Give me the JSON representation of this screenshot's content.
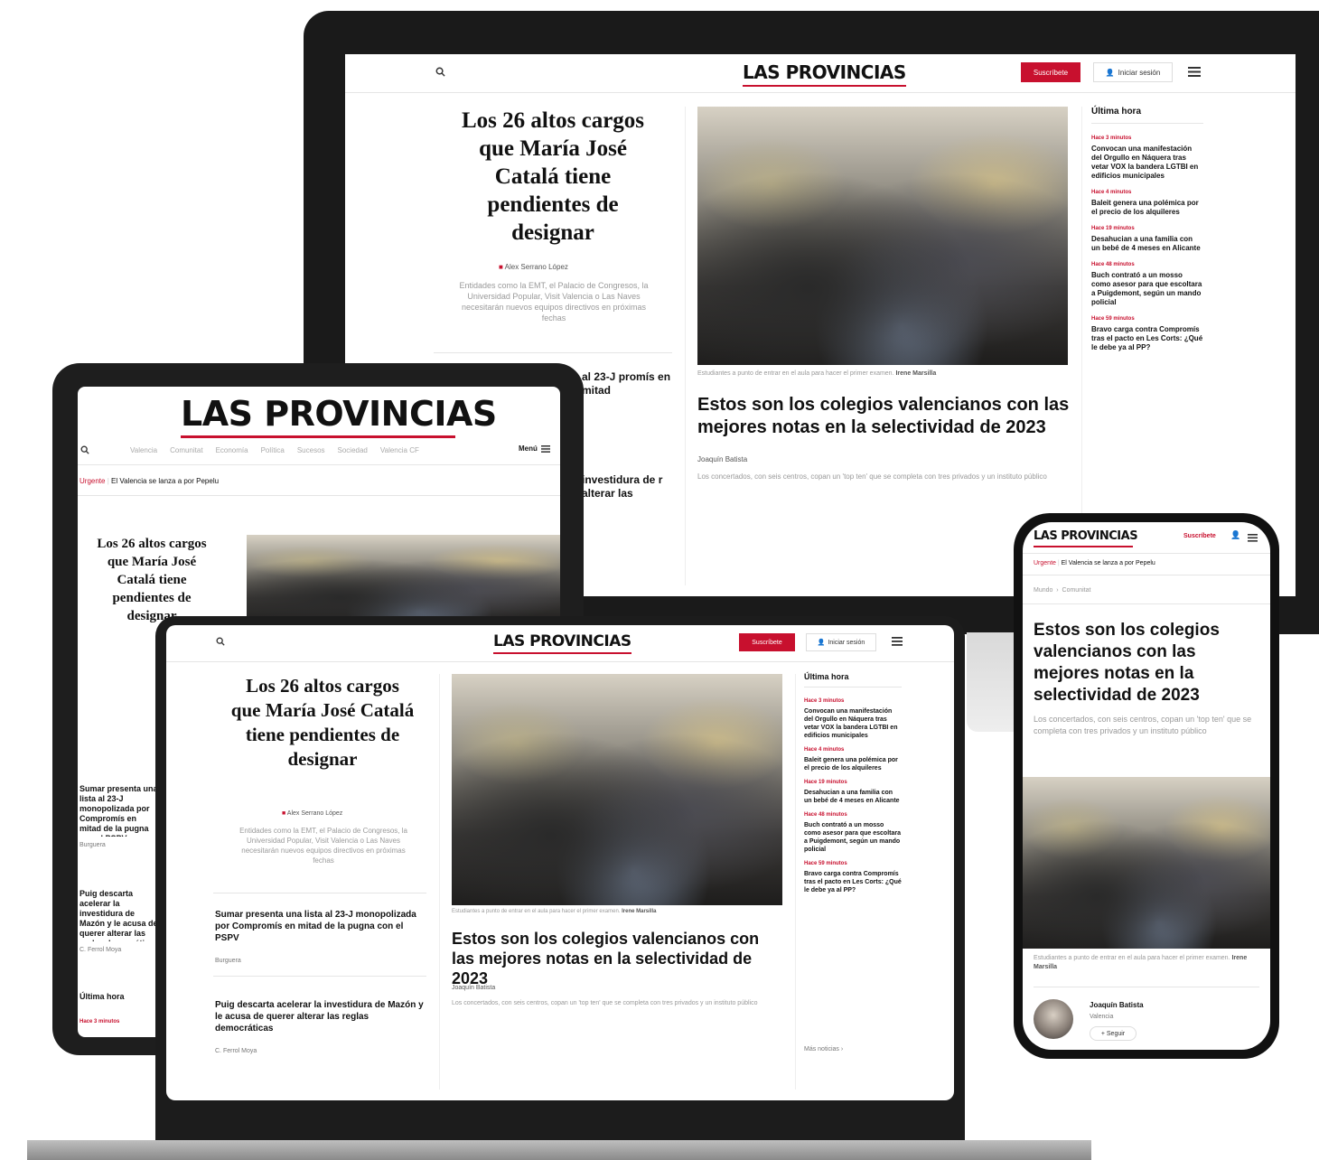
{
  "brand": {
    "name": "LAS PROVINCIAS",
    "accent": "#c8102e"
  },
  "header": {
    "subscribe": "Suscríbete",
    "login": "Iniciar sesión",
    "menu": "Menú"
  },
  "nav": {
    "items": [
      "Valencia",
      "Comunitat",
      "Economía",
      "Política",
      "Sucesos",
      "Sociedad",
      "Valencia CF"
    ]
  },
  "ticker": {
    "label": "Urgente",
    "text": "El Valencia se lanza a por Pepelu"
  },
  "phone_breadcrumb": {
    "section": "Mundo",
    "subsection": "Comunitat"
  },
  "main_story": {
    "title": "Los 26 altos cargos que María José Catalá tiene pendientes de designar",
    "author": "Alex Serrano López",
    "summary": "Entidades como la EMT, el Palacio de Congresos, la Universidad Popular, Visit Valencia o Las Naves necesitarán nuevos equipos directivos en próximas fechas"
  },
  "secondary_stories": [
    {
      "title": "Sumar presenta una lista al 23-J monopolizada por Compromís en mitad de la pugna con el PSPV",
      "author": "Burguera"
    },
    {
      "title": "Puig descarta acelerar la investidura de Mazón y le acusa de querer alterar las reglas democráticas",
      "author": "C. Ferrol Moya"
    }
  ],
  "feature": {
    "caption": "Estudiantes a punto de entrar en el aula para hacer el primer examen.",
    "caption_credit": "Irene Marsilla",
    "title": "Estos son los colegios valencianos con las mejores notas en la selectividad de 2023",
    "author": "Joaquín Batista",
    "summary": "Los concertados, con seis centros, copan un 'top ten' que se completa con tres privados y un instituto público"
  },
  "last_hour": {
    "heading": "Última hora",
    "items": [
      {
        "time": "Hace 3 minutos",
        "title": "Convocan una manifestación del Orgullo en Náquera tras vetar VOX la bandera LGTBI en edificios municipales"
      },
      {
        "time": "Hace 4 minutos",
        "title": "Baleit genera una polémica por el precio de los alquileres"
      },
      {
        "time": "Hace 19 minutos",
        "title": "Desahucian a una familia con un bebé de 4 meses en Alicante"
      },
      {
        "time": "Hace 48 minutos",
        "title": "Buch contrató a un mosso como asesor para que escoltara a Puigdemont, según un mando policial"
      },
      {
        "time": "Hace 59 minutos",
        "title": "Bravo carga contra Compromís tras el pacto en Les Corts: ¿Qué le debe ya al PP?"
      }
    ],
    "more": "Más noticias"
  },
  "author_card": {
    "name": "Joaquín Batista",
    "place": "Valencia",
    "follow": "+ Seguir"
  },
  "tablet_partial": {
    "story_a": "Sumar presenta una lista al 23-J monopolizada por Compromís en mitad de la pugna con el PSPV",
    "story_b": "Puig descarta acelerar la investidura de Mazón y le acusa de querer alterar las reglas democráticas",
    "behind_a": "al 23-J promís en mitad",
    "behind_b": "investidura de r alterar las"
  }
}
